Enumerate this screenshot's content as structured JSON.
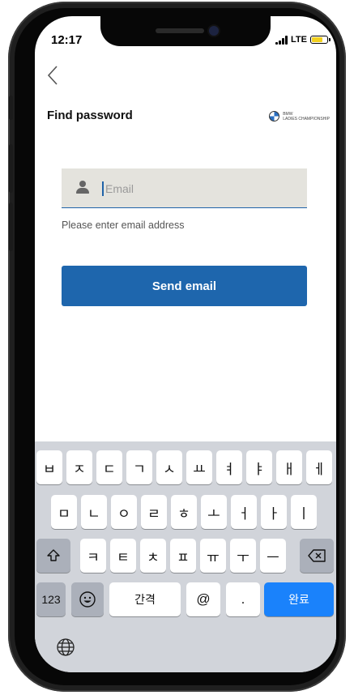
{
  "status": {
    "time": "12:17",
    "network": "LTE"
  },
  "header": {
    "back_icon": "chevron-left-icon",
    "title": "Find password",
    "brand_lines": [
      "BMW",
      "LADIES CHAMPIONSHIP"
    ]
  },
  "form": {
    "email_placeholder": "Email",
    "email_value": "",
    "hint": "Please enter email address",
    "send_label": "Send email"
  },
  "keyboard": {
    "row1": [
      "ㅂ",
      "ㅈ",
      "ㄷ",
      "ㄱ",
      "ㅅ",
      "ㅛ",
      "ㅕ",
      "ㅑ",
      "ㅐ",
      "ㅔ"
    ],
    "row2": [
      "ㅁ",
      "ㄴ",
      "ㅇ",
      "ㄹ",
      "ㅎ",
      "ㅗ",
      "ㅓ",
      "ㅏ",
      "ㅣ"
    ],
    "row3": [
      "ㅋ",
      "ㅌ",
      "ㅊ",
      "ㅍ",
      "ㅠ",
      "ㅜ",
      "ㅡ"
    ],
    "shift_icon": "shift-arrow-icon",
    "backspace_icon": "backspace-icon",
    "numbers": "123",
    "emoji_icon": "emoji-icon",
    "space": "간격",
    "at": "@",
    "period": ".",
    "done": "완료",
    "globe_icon": "globe-icon"
  },
  "colors": {
    "accent": "#1e66ad",
    "input_bg": "#e4e3dd",
    "keyboard_bg": "#d1d4da",
    "done_key": "#1a82fb"
  }
}
